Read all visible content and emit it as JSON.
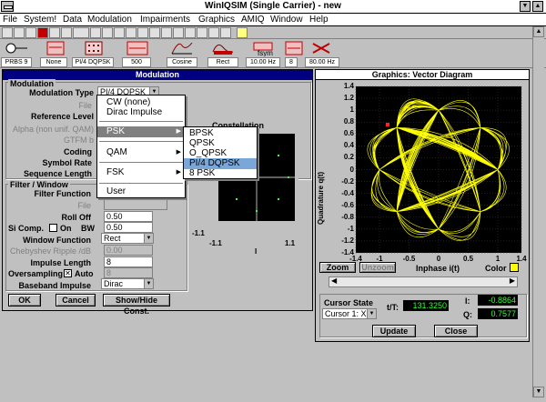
{
  "window": {
    "title": "WinIQSIM (Single Carrier) - new"
  },
  "menubar": {
    "items": [
      "File",
      "System!",
      "Data",
      "Modulation",
      "Impairments",
      "Graphics",
      "AMIQ",
      "Window",
      "Help"
    ]
  },
  "modbar": {
    "values": [
      "PRBS 9",
      "None",
      "PI/4 DQPSK",
      "500",
      "Cosine",
      "Rect",
      "10.00 Hz",
      "8",
      "80.00 Hz"
    ],
    "icons": [
      "Data",
      "Coding",
      "Modul",
      "Seq Len",
      "Filter",
      "Window",
      "fSym",
      "Over",
      "Clock"
    ]
  },
  "modulation": {
    "title": "Modulation",
    "group_modulation": "Modulation",
    "modtype_label": "Modulation Type",
    "modtype_value": "PI/4 DQPSK",
    "file_label": "File",
    "reflevel_label": "Reference Level",
    "alpha_label": "Alpha (non unif. QAM)",
    "gtfm_label": "GTFM b",
    "coding_label": "Coding",
    "symrate_label": "Symbol Rate",
    "seqlen_label": "Sequence Length",
    "constellation_label": "Constellation",
    "const_axis": {
      "y_top": "1.1",
      "y_bot": "-1.1",
      "x_left": "-1.1",
      "x_right": "1.1",
      "x_label": "I"
    },
    "group_filter": "Filter / Window",
    "filterfunc_label": "Filter Function",
    "file2_label": "File",
    "rolloff_label": "Roll Off",
    "rolloff_value": "0.50",
    "sicomp_label": "Si Comp.",
    "on_label": "On",
    "bw_label": "BW",
    "bw_value": "0.50",
    "winfunc_label": "Window Function",
    "winfunc_value": "Rect",
    "cheb_label": "Chebyshev Ripple /dB",
    "cheb_value": "0.00",
    "implen_label": "Impulse Length",
    "implen_value": "8",
    "overs_label": "Oversampling",
    "auto_label": "Auto",
    "overs_value": "8",
    "baseband_label": "Baseband Impulse",
    "baseband_value": "Dirac",
    "ok": "OK",
    "cancel": "Cancel",
    "showhide": "Show/Hide Const."
  },
  "dropdown": {
    "items": [
      "CW (none)",
      "Dirac Impulse",
      "PSK",
      "QAM",
      "FSK",
      "User"
    ]
  },
  "submenu": {
    "items": [
      "BPSK",
      "QPSK",
      "O_QPSK",
      "PI/4 DQPSK",
      "8 PSK"
    ]
  },
  "graphics": {
    "title": "Graphics: Vector Diagram",
    "ylabel": "Quadrature q(t)",
    "xlabel": "Inphase i(t)",
    "yticks": [
      "1.4",
      "1.2",
      "1",
      "0.8",
      "0.6",
      "0.4",
      "0.2",
      "0",
      "-0.2",
      "-0.4",
      "-0.6",
      "-0.8",
      "-1",
      "-1.2",
      "-1.4"
    ],
    "xticks": [
      "-1.4",
      "-1",
      "-0.5",
      "0",
      "0.5",
      "1",
      "1.4"
    ],
    "zoom": "Zoom",
    "unzoom": "Unzoom",
    "color": "Color",
    "cursor_state": "Cursor State",
    "cursor_value": "Cursor 1: X",
    "tt_label": "t/T:",
    "tt_value": "131.3250",
    "i_label": "I:",
    "i_value": "-0.8864",
    "q_label": "Q:",
    "q_value": "0.7577",
    "update": "Update",
    "close": "Close",
    "trace_color": "#ffff00"
  }
}
